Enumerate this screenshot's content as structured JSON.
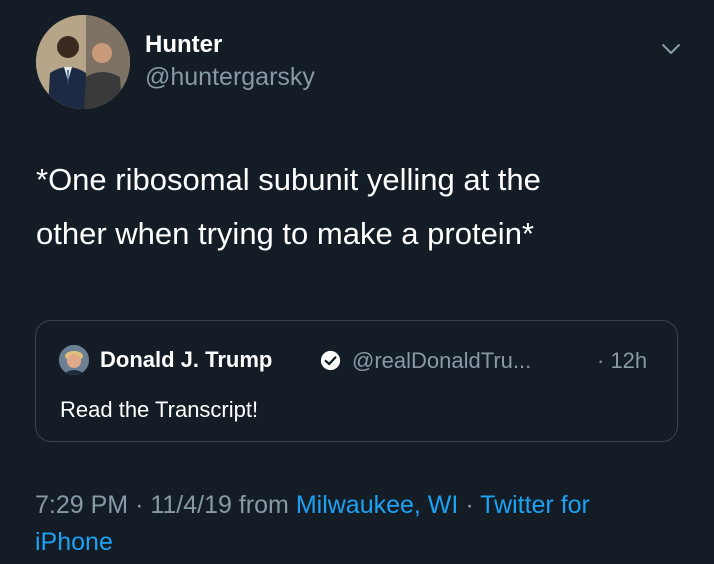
{
  "author": {
    "name": "Hunter",
    "handle": "@huntergarsky"
  },
  "tweet": {
    "text_line1": "*One ribosomal subunit yelling at the",
    "text_line2": "other when trying to make a protein*"
  },
  "quoted": {
    "name": "Donald J. Trump",
    "handle": "@realDonaldTru...",
    "time": "· 12h",
    "text": "Read the Transcript!"
  },
  "meta": {
    "time": "7:29 PM",
    "date": "11/4/19",
    "from_label": "from",
    "location": "Milwaukee, WI",
    "sep": "·",
    "source_part1": "Twitter for",
    "source_part2": "iPhone"
  },
  "colors": {
    "background": "#141d26",
    "secondary_text": "#8899a6",
    "link": "#1da1f2",
    "border": "#38444d"
  },
  "icons": [
    "chevron-down-icon",
    "verified-badge-icon"
  ]
}
